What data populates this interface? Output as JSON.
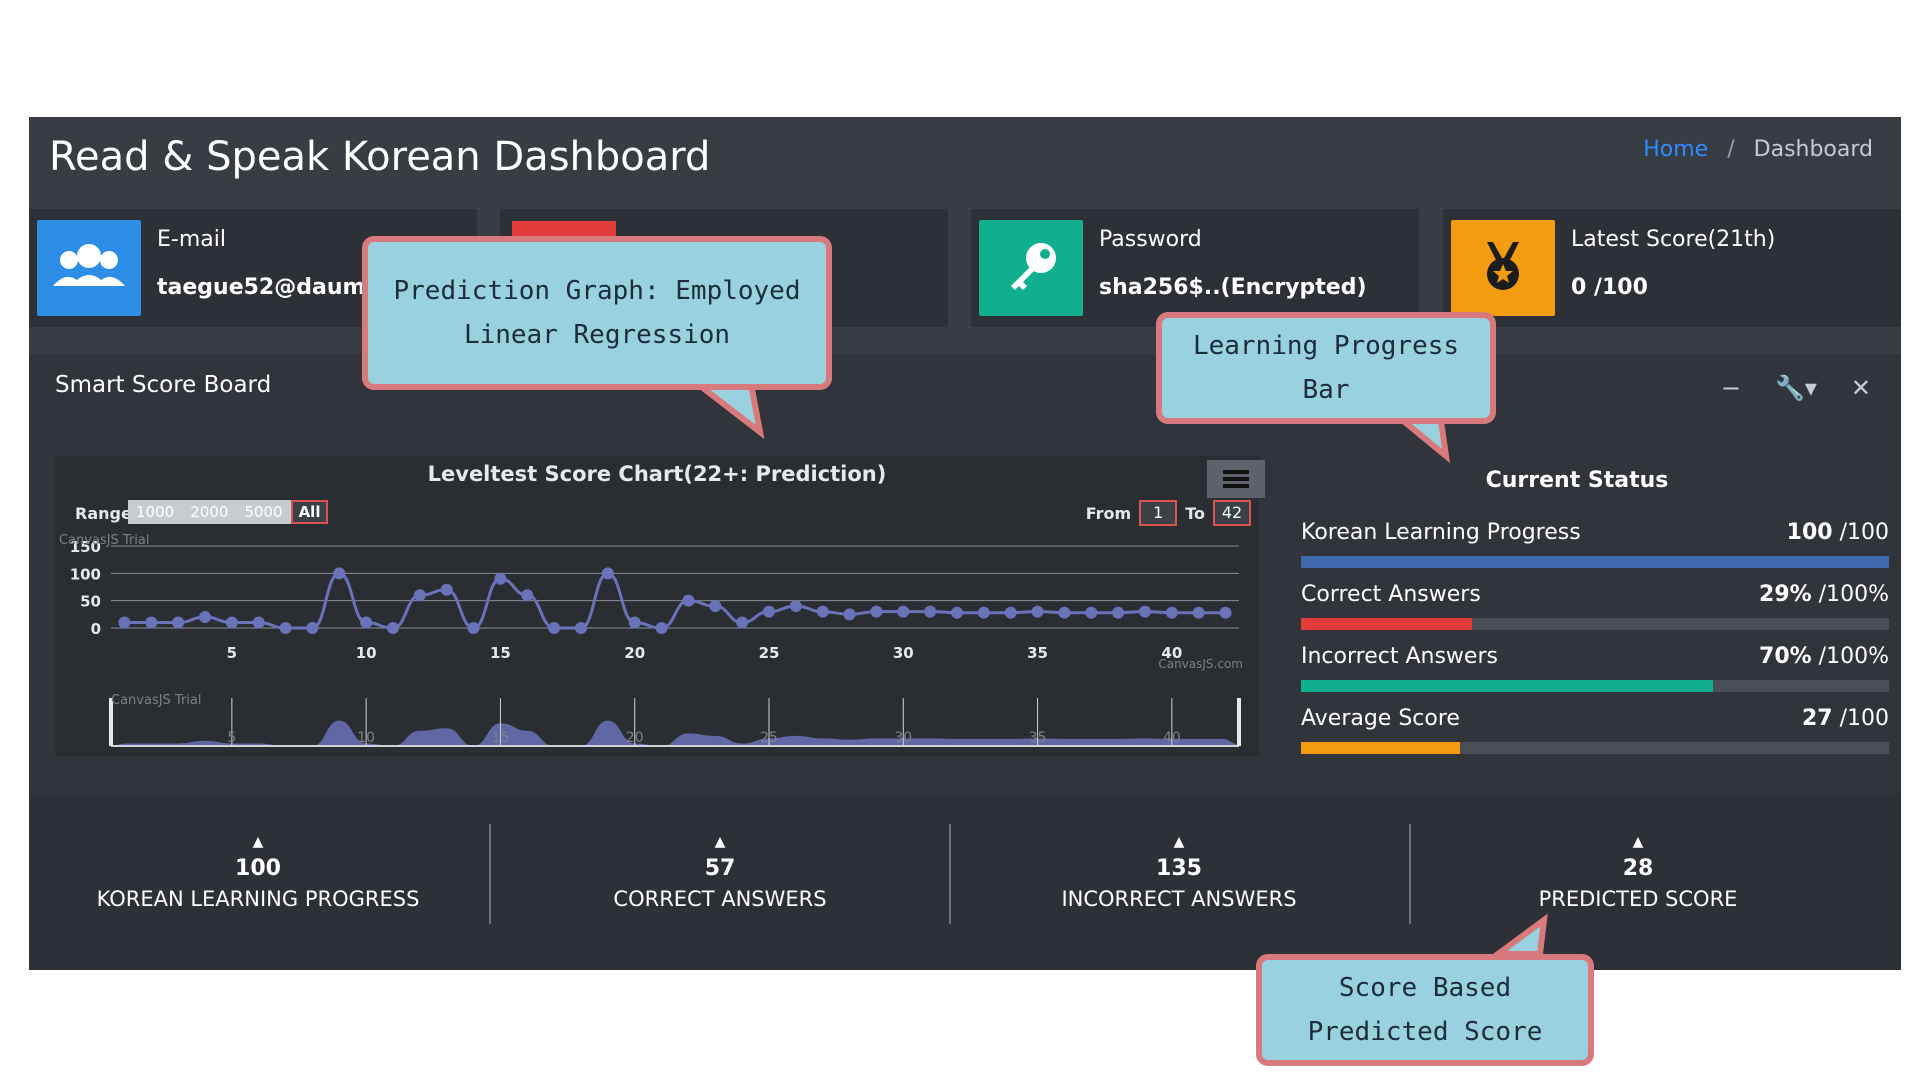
{
  "header": {
    "title": "Read & Speak Korean Dashboard",
    "breadcrumb_home": "Home",
    "breadcrumb_sep": "/",
    "breadcrumb_current": "Dashboard"
  },
  "info_boxes": [
    {
      "label": "E-mail",
      "value": "taegue52@daum.ne",
      "icon": "users-icon",
      "color": "#2e8de6"
    },
    {
      "label": "",
      "value": "",
      "icon": "unknown-icon",
      "color": "#e23b3b"
    },
    {
      "label": "Password",
      "value": "sha256$..(Encrypted)",
      "icon": "key-icon",
      "color": "#10b08e"
    },
    {
      "label": "Latest Score(21th)",
      "value": "0 /100",
      "icon": "medal-icon",
      "color": "#f39c12"
    }
  ],
  "panel": {
    "title": "Smart Score Board",
    "tools": {
      "minimize": "−",
      "settings": "🔧▾",
      "close": "✕"
    }
  },
  "chart_data": {
    "type": "line",
    "title": "Leveltest Score Chart(22+: Prediction)",
    "range_label": "Range",
    "range_options": [
      "1000",
      "2000",
      "5000",
      "All"
    ],
    "range_selected": "All",
    "from_label": "From",
    "from_value": "1",
    "to_label": "To",
    "to_value": "42",
    "watermark": "CanvasJS Trial",
    "credit": "CanvasJS.com",
    "xlim": [
      0.5,
      42.5
    ],
    "ylim": [
      0,
      150
    ],
    "yticks": [
      0,
      50,
      100,
      150
    ],
    "xticks": [
      5,
      10,
      15,
      20,
      25,
      30,
      35,
      40
    ],
    "series": [
      {
        "x": [
          1,
          2,
          3,
          4,
          5,
          6,
          7,
          8,
          9,
          10,
          11,
          12,
          13,
          14,
          15,
          16,
          17,
          18,
          19,
          20,
          21,
          22,
          23,
          24,
          25,
          26,
          27,
          28,
          29,
          30,
          31,
          32,
          33,
          34,
          35,
          36,
          37,
          38,
          39,
          40,
          41,
          42
        ],
        "values": [
          10,
          10,
          10,
          20,
          10,
          10,
          0,
          0,
          100,
          10,
          0,
          60,
          70,
          0,
          90,
          60,
          0,
          0,
          100,
          10,
          0,
          50,
          40,
          10,
          30,
          40,
          30,
          25,
          30,
          30,
          30,
          28,
          28,
          28,
          30,
          28,
          28,
          28,
          30,
          28,
          28,
          28
        ],
        "color": "#6a72b8"
      }
    ]
  },
  "status": {
    "title": "Current Status",
    "rows": [
      {
        "label": "Korean Learning Progress",
        "value": "100",
        "unit": " /100",
        "pct": 1.0,
        "color": "#3e6aad"
      },
      {
        "label": "Correct Answers",
        "value": "29%",
        "unit": " /100%",
        "pct": 0.29,
        "color": "#e23b3b"
      },
      {
        "label": "Incorrect Answers",
        "value": "70%",
        "unit": " /100%",
        "pct": 0.7,
        "color": "#10b08e"
      },
      {
        "label": "Average Score",
        "value": "27",
        "unit": " /100",
        "pct": 0.27,
        "color": "#f39c12"
      }
    ]
  },
  "footer": [
    {
      "num": "100",
      "label": "KOREAN LEARNING PROGRESS"
    },
    {
      "num": "57",
      "label": "CORRECT ANSWERS"
    },
    {
      "num": "135",
      "label": "INCORRECT ANSWERS"
    },
    {
      "num": "28",
      "label": "PREDICTED SCORE"
    }
  ],
  "callouts": {
    "prediction": [
      "Prediction Graph: Employed",
      "Linear Regression"
    ],
    "progress": "Learning Progress Bar",
    "score": [
      "Score Based",
      "Predicted Score"
    ]
  }
}
